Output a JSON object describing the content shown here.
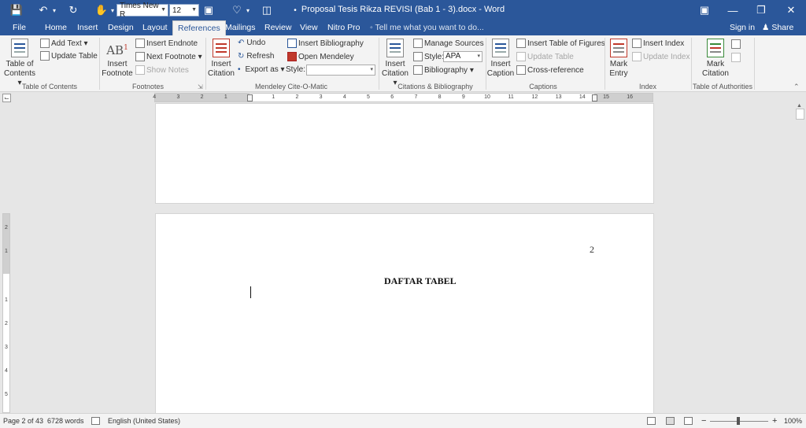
{
  "titlebar": {
    "font_name": "Times New R",
    "font_size": "12",
    "doc_title": "Proposal Tesis Rikza REVISI (Bab 1 - 3).docx - Word",
    "bg_color": "#2b579a"
  },
  "tabs": {
    "items": [
      "File",
      "Home",
      "Insert",
      "Design",
      "Layout",
      "References",
      "Mailings",
      "Review",
      "View",
      "Nitro Pro"
    ],
    "active": "References",
    "tell_me": "Tell me what you want to do...",
    "sign_in": "Sign in",
    "share": "Share"
  },
  "ribbon": {
    "toc": {
      "table_of_contents": "Table of",
      "table_of_contents_2": "Contents",
      "add_text": "Add Text",
      "update_table": "Update Table",
      "group": "Table of Contents"
    },
    "footnotes": {
      "ab_glyph": "AB",
      "insert_footnote": "Insert",
      "insert_footnote_2": "Footnote",
      "insert_endnote": "Insert Endnote",
      "next_footnote": "Next Footnote",
      "show_notes": "Show Notes",
      "group": "Footnotes"
    },
    "mendeley": {
      "insert_citation": "Insert",
      "insert_citation_2": "Citation",
      "undo": "Undo",
      "refresh": "Refresh",
      "export_as": "Export as",
      "insert_bibliography": "Insert Bibliography",
      "open_mendeley": "Open Mendeley",
      "style_label": "Style:",
      "style_value": "",
      "group": "Mendeley Cite-O-Matic"
    },
    "citations": {
      "insert_citation": "Insert",
      "insert_citation_2": "Citation",
      "manage_sources": "Manage Sources",
      "style_label": "Style:",
      "style_value": "APA",
      "bibliography": "Bibliography",
      "group": "Citations & Bibliography"
    },
    "captions": {
      "insert_caption": "Insert",
      "insert_caption_2": "Caption",
      "insert_table_of_figures": "Insert Table of Figures",
      "update_table": "Update Table",
      "cross_reference": "Cross-reference",
      "group": "Captions"
    },
    "index": {
      "mark_entry": "Mark",
      "mark_entry_2": "Entry",
      "insert_index": "Insert Index",
      "update_index": "Update Index",
      "group": "Index"
    },
    "authorities": {
      "mark_citation": "Mark",
      "mark_citation_2": "Citation",
      "group": "Table of Authorities"
    }
  },
  "ruler": {
    "marks": [
      "4",
      "3",
      "2",
      "1",
      "1",
      "2",
      "3",
      "4",
      "5",
      "6",
      "7",
      "8",
      "9",
      "10",
      "11",
      "12",
      "13",
      "14",
      "15",
      "16"
    ],
    "vertical_marks": [
      "2",
      "1",
      "1",
      "2",
      "3",
      "4",
      "5"
    ]
  },
  "document": {
    "page_number": "2",
    "heading": "DAFTAR TABEL"
  },
  "status": {
    "page": "Page 2 of 43",
    "words": "6728 words",
    "language": "English (United States)",
    "zoom_minus": "−",
    "zoom_plus": "+",
    "zoom": "100%",
    "zoom_level_percent": 100
  }
}
